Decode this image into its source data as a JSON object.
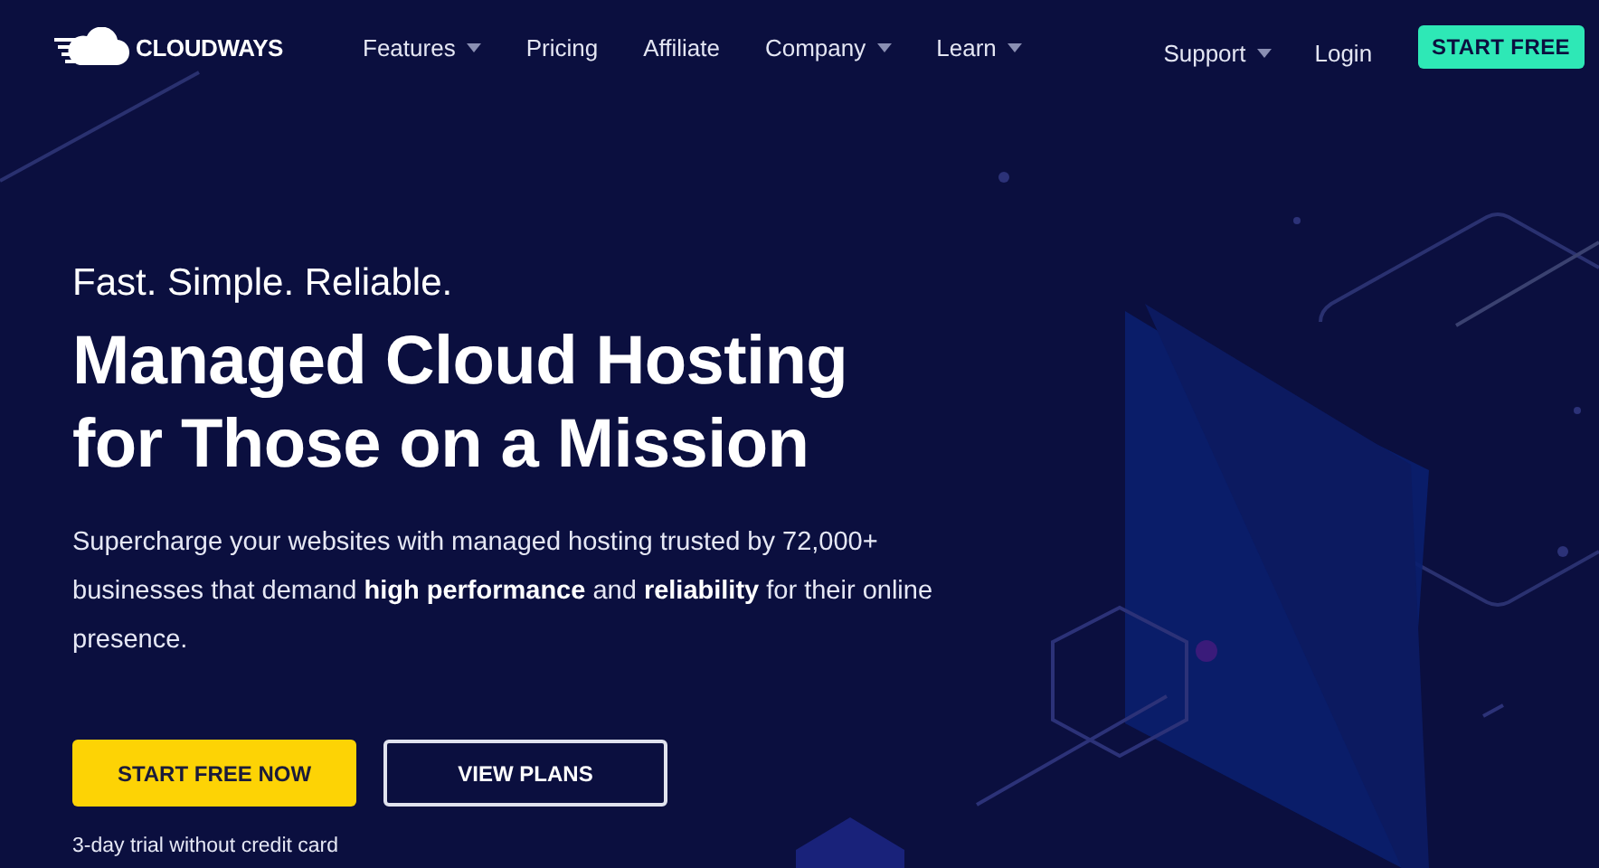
{
  "logo": {
    "text": "CLOUDWAYS"
  },
  "nav": {
    "items": [
      {
        "label": "Features",
        "dropdown": true
      },
      {
        "label": "Pricing",
        "dropdown": false
      },
      {
        "label": "Affiliate",
        "dropdown": false
      },
      {
        "label": "Company",
        "dropdown": true
      },
      {
        "label": "Learn",
        "dropdown": true
      }
    ],
    "right_items": [
      {
        "label": "Support",
        "dropdown": true
      },
      {
        "label": "Login",
        "dropdown": false
      }
    ],
    "cta": "START FREE"
  },
  "hero": {
    "tagline": "Fast. Simple. Reliable.",
    "title_lines": [
      "Managed Cloud Hosting",
      "for Those on a Mission"
    ],
    "description": "Supercharge your websites with managed hosting trusted by 72,000+ businesses that demand **high performance** and **reliability** for their online presence.",
    "buttons": [
      {
        "label": "START FREE NOW",
        "kind": "primary"
      },
      {
        "label": "VIEW PLANS",
        "kind": "outline"
      }
    ],
    "note": "3-day trial without credit card"
  }
}
